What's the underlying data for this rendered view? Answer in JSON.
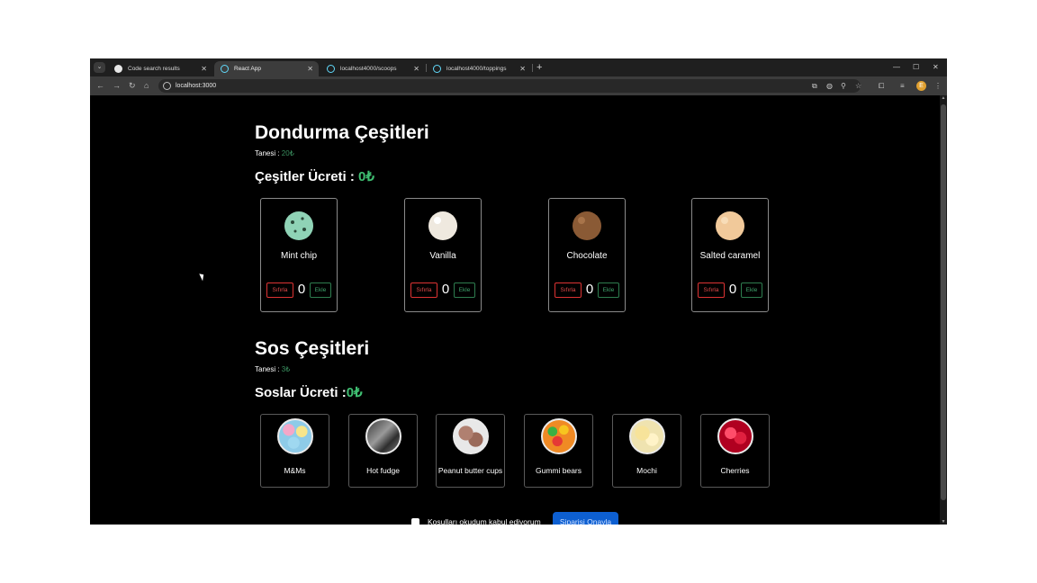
{
  "browser": {
    "tabs": [
      {
        "label": "Code search results"
      },
      {
        "label": "React App"
      },
      {
        "label": "localhost4000/scoops"
      },
      {
        "label": "localhost4000/toppings"
      }
    ],
    "url": "localhost:3000",
    "profile_initial": "E"
  },
  "scoops": {
    "title": "Dondurma Çeşitleri",
    "unit_label": "Tanesi : ",
    "unit_price": "20₺",
    "total_label": "Çeşitler Ücreti : ",
    "total_value": "0₺",
    "items": [
      {
        "name": "Mint chip",
        "reset_label": "Sıfırla",
        "quantity": "0",
        "add_label": "Ekle",
        "color": "#8fd3b6"
      },
      {
        "name": "Vanilla",
        "reset_label": "Sıfırla",
        "quantity": "0",
        "add_label": "Ekle",
        "color": "#efe9df"
      },
      {
        "name": "Chocolate",
        "reset_label": "Sıfırla",
        "quantity": "0",
        "add_label": "Ekle",
        "color": "#8a5a35"
      },
      {
        "name": "Salted caramel",
        "reset_label": "Sıfırla",
        "quantity": "0",
        "add_label": "Ekle",
        "color": "#f1c99a"
      }
    ]
  },
  "toppings": {
    "title": "Sos Çeşitleri",
    "unit_label": "Tanesi : ",
    "unit_price": "3₺",
    "total_label": "Soslar Ücreti :",
    "total_value": "0₺",
    "items": [
      {
        "name": "M&Ms",
        "color": "#8ecbe8"
      },
      {
        "name": "Hot fudge",
        "color": "#6b6b6b"
      },
      {
        "name": "Peanut butter cups",
        "color": "#8a5a4a"
      },
      {
        "name": "Gummi bears",
        "color": "#d9462f"
      },
      {
        "name": "Mochi",
        "color": "#f2e6b8"
      },
      {
        "name": "Cherries",
        "color": "#c8102e"
      }
    ]
  },
  "order": {
    "terms_label": "Koşulları okudum kabul ediyorum",
    "confirm_label": "Siparişi Onayla"
  }
}
